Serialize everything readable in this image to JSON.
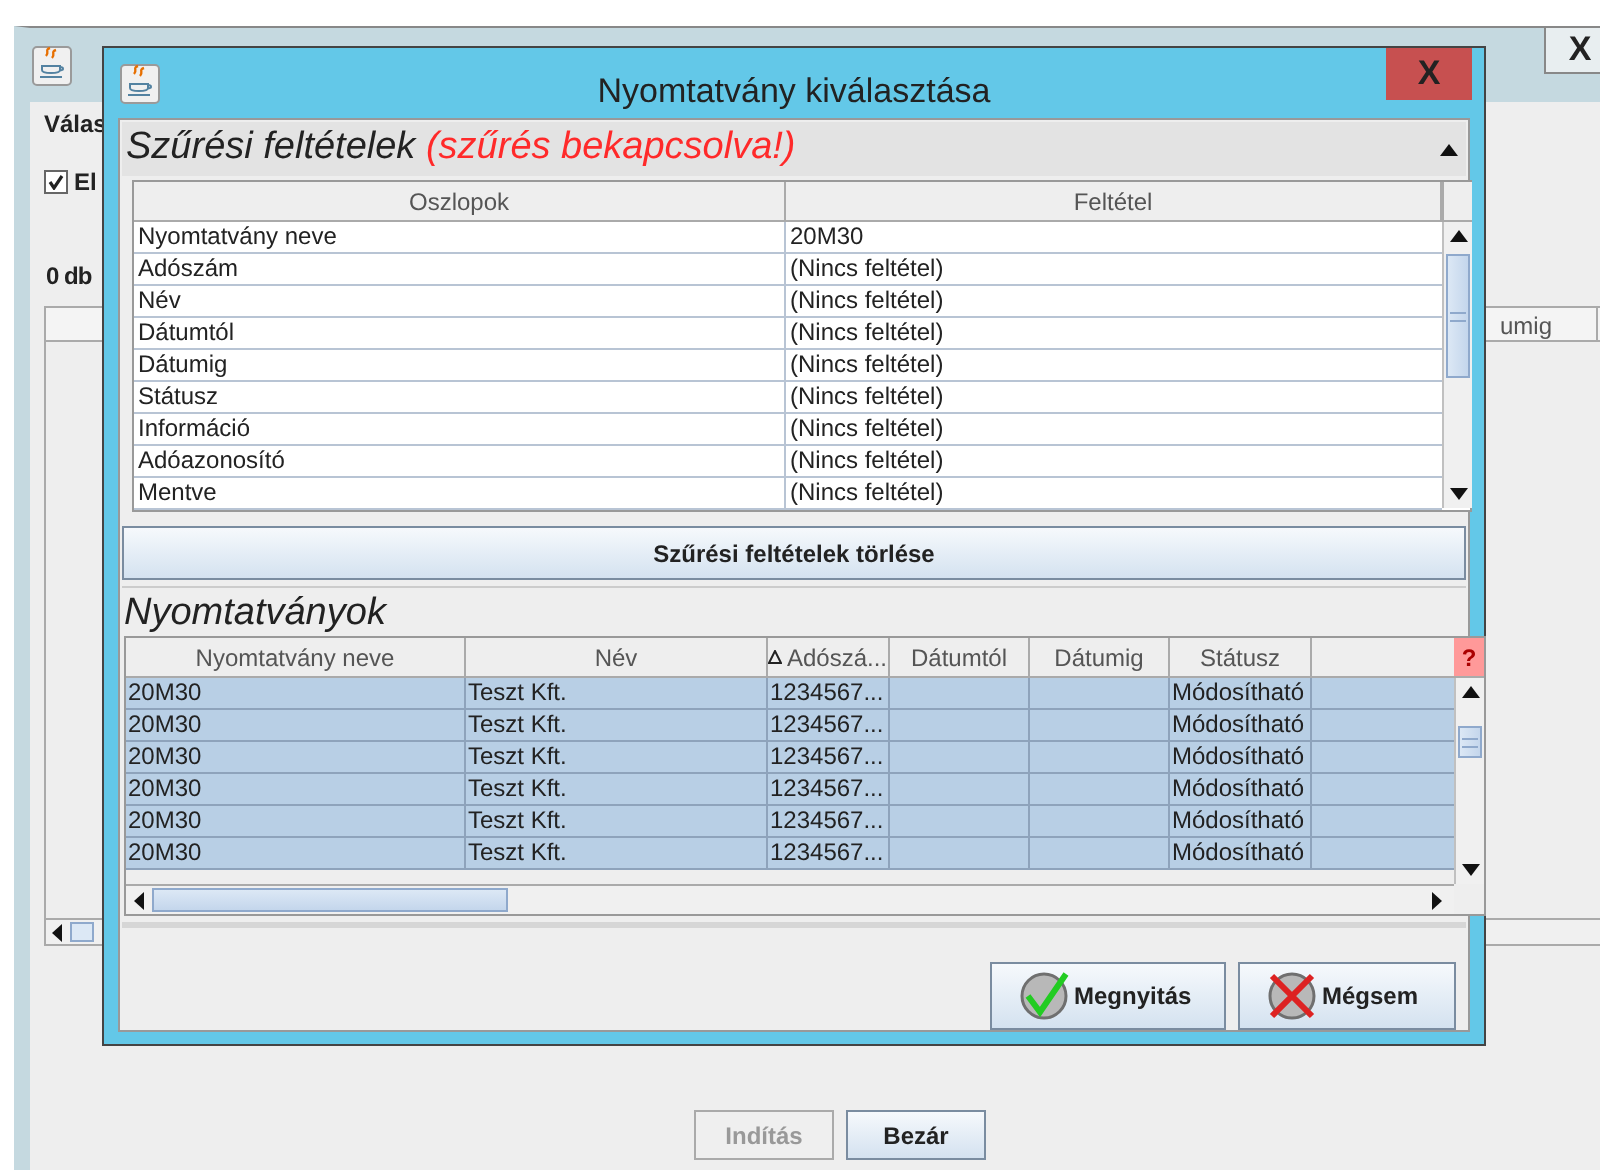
{
  "background_window": {
    "heading": "Válas",
    "checkbox": {
      "label": "El",
      "checked": true
    },
    "count": "0 db",
    "column_header": "umig",
    "close_button": "X",
    "buttons": [
      {
        "label": "Indítás",
        "disabled": true
      },
      {
        "label": "Bezár",
        "disabled": false
      }
    ]
  },
  "dialog": {
    "title": "Nyomtatvány kiválasztása",
    "close_button": "X",
    "filter_section": {
      "title": "Szűrési feltételek",
      "status": "(szűrés bekapcsolva!)",
      "expanded": true,
      "columns": [
        "Oszlopok",
        "Feltétel"
      ],
      "rows": [
        {
          "column": "Nyomtatvány neve",
          "condition": "20M30"
        },
        {
          "column": "Adószám",
          "condition": "(Nincs feltétel)"
        },
        {
          "column": "Név",
          "condition": "(Nincs feltétel)"
        },
        {
          "column": "Dátumtól",
          "condition": "(Nincs feltétel)"
        },
        {
          "column": "Dátumig",
          "condition": "(Nincs feltétel)"
        },
        {
          "column": "Státusz",
          "condition": "(Nincs feltétel)"
        },
        {
          "column": "Információ",
          "condition": "(Nincs feltétel)"
        },
        {
          "column": "Adóazonosító",
          "condition": "(Nincs feltétel)"
        },
        {
          "column": "Mentve",
          "condition": "(Nincs feltétel)"
        }
      ]
    },
    "clear_button": "Szűrési feltételek törlése",
    "forms_section": {
      "title": "Nyomtatványok",
      "help_button": "?",
      "columns": [
        {
          "label": "Nyomtatvány neve",
          "sorted": false
        },
        {
          "label": "Név",
          "sorted": false
        },
        {
          "label": "Adószá...",
          "sorted": true
        },
        {
          "label": "Dátumtól",
          "sorted": false
        },
        {
          "label": "Dátumig",
          "sorted": false
        },
        {
          "label": "Státusz",
          "sorted": false
        }
      ],
      "rows": [
        {
          "cells": [
            "20M30",
            "Teszt Kft.",
            "1234567...",
            "",
            "",
            "Módosítható"
          ],
          "selected": true
        },
        {
          "cells": [
            "20M30",
            "Teszt Kft.",
            "1234567...",
            "",
            "",
            "Módosítható"
          ],
          "selected": true
        },
        {
          "cells": [
            "20M30",
            "Teszt Kft.",
            "1234567...",
            "",
            "",
            "Módosítható"
          ],
          "selected": true
        },
        {
          "cells": [
            "20M30",
            "Teszt Kft.",
            "1234567...",
            "",
            "",
            "Módosítható"
          ],
          "selected": true
        },
        {
          "cells": [
            "20M30",
            "Teszt Kft.",
            "1234567...",
            "",
            "",
            "Módosítható"
          ],
          "selected": true
        },
        {
          "cells": [
            "20M30",
            "Teszt Kft.",
            "1234567...",
            "",
            "",
            "Módosítható"
          ],
          "selected": true
        }
      ]
    },
    "buttons": [
      {
        "label": "Megnyitás",
        "kind": "ok"
      },
      {
        "label": "Mégsem",
        "kind": "cancel"
      }
    ]
  }
}
